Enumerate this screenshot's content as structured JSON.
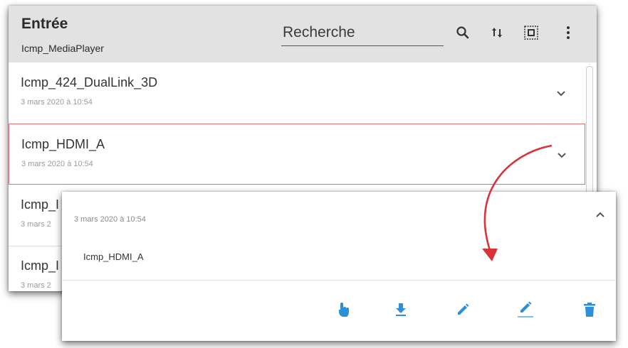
{
  "header": {
    "title": "Entrée",
    "subtitle": "Icmp_MediaPlayer",
    "search_placeholder": "Recherche"
  },
  "icons": {
    "search": "search-icon",
    "sort": "sort-icon",
    "select_all": "select-all-icon",
    "more": "more-vert-icon"
  },
  "rows": [
    {
      "title": "Icmp_424_DualLink_3D",
      "date": "3 mars 2020 à 10:54"
    },
    {
      "title": "Icmp_HDMI_A",
      "date": "3 mars 2020 à 10:54",
      "selected": true
    },
    {
      "title": "Icmp_I",
      "date": "3 mars 2"
    },
    {
      "title": "Icmp_I",
      "date": "3 mars 2"
    }
  ],
  "expanded": {
    "date": "3 mars 2020 à 10:54",
    "name": "Icmp_HDMI_A",
    "actions": [
      "touch-icon",
      "download-icon",
      "edit-icon",
      "edit-underline-icon",
      "delete-icon"
    ]
  },
  "colors": {
    "header_bg": "#e2e2e2",
    "accent": "#2d8fd5",
    "selected_border": "#e07070",
    "arrow": "#d9333a"
  }
}
